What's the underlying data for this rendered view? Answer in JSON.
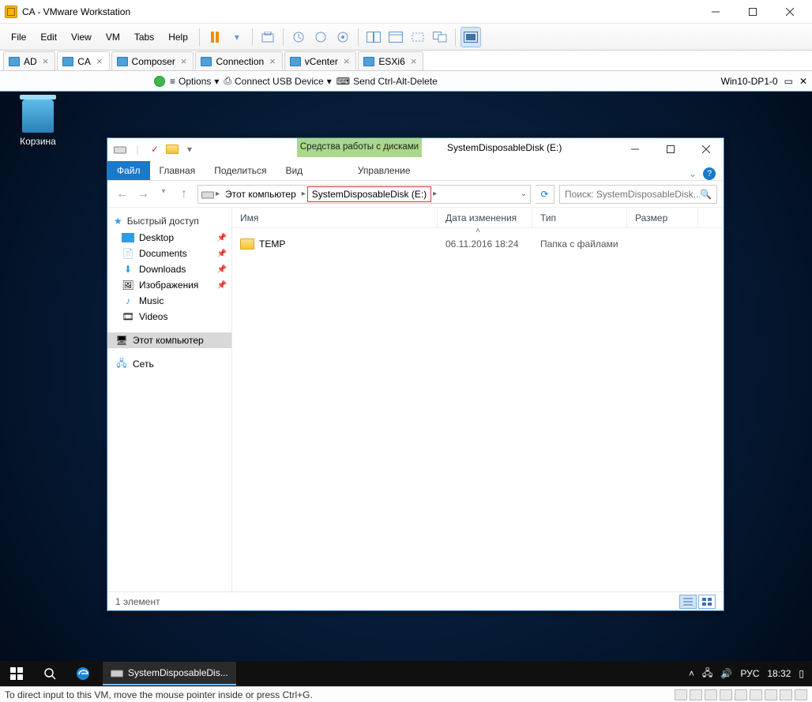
{
  "host": {
    "title": "CA - VMware Workstation",
    "menu": [
      "File",
      "Edit",
      "View",
      "VM",
      "Tabs",
      "Help"
    ],
    "tabs": [
      {
        "label": "AD"
      },
      {
        "label": "CA",
        "active": true
      },
      {
        "label": "Composer"
      },
      {
        "label": "Connection"
      },
      {
        "label": "vCenter"
      },
      {
        "label": "ESXi6"
      }
    ],
    "conn": {
      "options": "Options",
      "usb": "Connect USB Device",
      "cad": "Send Ctrl-Alt-Delete",
      "vmname": "Win10-DP1-0"
    },
    "status": "To direct input to this VM, move the mouse pointer inside or press Ctrl+G."
  },
  "guest": {
    "recycle": "Корзина",
    "explorer": {
      "context_title": "Средства работы с дисками",
      "window_title": "SystemDisposableDisk (E:)",
      "ribbon": {
        "file": "Файл",
        "home": "Главная",
        "share": "Поделиться",
        "view": "Вид",
        "manage": "Управление"
      },
      "breadcrumb": {
        "root": "Этот компьютер",
        "drive": "SystemDisposableDisk (E:)"
      },
      "search_placeholder": "Поиск: SystemDisposableDisk...",
      "sidebar": {
        "quick": "Быстрый доступ",
        "items": [
          "Desktop",
          "Documents",
          "Downloads",
          "Изображения",
          "Music",
          "Videos"
        ],
        "this_pc": "Этот компьютер",
        "network": "Сеть"
      },
      "columns": {
        "name": "Имя",
        "date": "Дата изменения",
        "type": "Тип",
        "size": "Размер"
      },
      "rows": [
        {
          "name": "TEMP",
          "date": "06.11.2016 18:24",
          "type": "Папка с файлами",
          "size": ""
        }
      ],
      "status": "1 элемент"
    },
    "taskbar": {
      "app": "SystemDisposableDis...",
      "lang": "РУС",
      "time": "18:32"
    }
  }
}
